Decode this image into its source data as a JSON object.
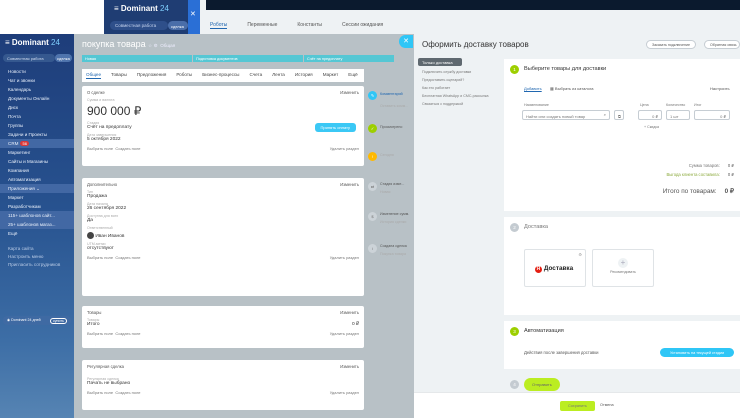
{
  "background_window": {
    "brand": "Dominant",
    "brand_num": "24",
    "workspace": "Совместная работа",
    "workspace_btn": "сделка",
    "tabs": [
      "Роботы",
      "Переменные",
      "Константы",
      "Сессии ожидания"
    ]
  },
  "sidebar": {
    "brand": "Dominant",
    "brand_num": "24",
    "workspace": "Совместная работа",
    "workspace_btn": "сделка",
    "items": [
      {
        "label": "Новости"
      },
      {
        "label": "Чат и звонки"
      },
      {
        "label": "Календарь"
      },
      {
        "label": "Документы Онлайн"
      },
      {
        "label": "Диск"
      },
      {
        "label": "Почта"
      },
      {
        "label": "Группы"
      },
      {
        "label": "Задачи и Проекты"
      },
      {
        "label": "CRM",
        "badge": "56"
      },
      {
        "label": "Маркетинг"
      },
      {
        "label": "Сайты и Магазины"
      },
      {
        "label": "Компания"
      },
      {
        "label": "Автоматизация"
      },
      {
        "label": "Приложения"
      },
      {
        "label": "Маркет"
      },
      {
        "label": "Разработчикам"
      },
      {
        "label": "115+ шаблонов сайт..."
      },
      {
        "label": "25+ шаблонов магаз..."
      },
      {
        "label": "Ещё"
      }
    ],
    "small_items": [
      "Карта сайта",
      "Настроить меню",
      "Пригласить сотрудников"
    ],
    "user": "Dominant 24 дней",
    "user_btn": "купить"
  },
  "deal": {
    "title": "покупка товара",
    "subtitle": "Общая",
    "stages": [
      "Новая",
      "Подготовка документов",
      "Счёт на предоплату"
    ],
    "tabs": [
      "Общее",
      "Товары",
      "Предложения",
      "Роботы",
      "Бизнес-процессы",
      "Счета",
      "Лента",
      "История",
      "Маркет",
      "Ещё"
    ],
    "about": {
      "header": "О сделке",
      "header_right": "Изменить",
      "amount_label": "Сумма и валюта",
      "amount": "900 000 ₽",
      "pay_btn": "Принять оплату",
      "stage_label": "Стадия",
      "stage": "Счёт на предоплату",
      "date_label": "Дата завершения",
      "date": "5 октября 2022",
      "link1": "Выбрать поле",
      "link2": "Создать поле",
      "link3": "Удалить раздел"
    },
    "more": {
      "header": "Дополнительно",
      "header_right": "Изменить",
      "type_label": "Тип",
      "type": "Продажа",
      "start_label": "Дата начала",
      "start": "26 сентября 2022",
      "avail_label": "Доступна для всех",
      "avail": "Да",
      "resp_label": "Ответственный",
      "resp": "Иван Иванов",
      "utm_label": "UTM-метки",
      "utm": "отсутствуют",
      "link1": "Выбрать поле",
      "link2": "Создать поле",
      "link3": "Удалить раздел"
    },
    "goods": {
      "header": "Товары",
      "header_right": "Изменить",
      "total_label": "Товары",
      "total": "Итого",
      "total_val": "0 ₽",
      "link1": "Выбрать поле",
      "link2": "Создать поле",
      "link3": "Удалить раздел"
    },
    "recurring": {
      "header": "Регулярная сделка",
      "header_right": "Изменить",
      "label": "Регулярная сделка",
      "value": "Пачать не выбрано",
      "link1": "Выбрать поле",
      "link2": "Создать поле",
      "link3": "Удалить раздел"
    },
    "timeline": [
      "Комментарий",
      "Оставить комм...",
      "Просмотрено",
      "Сегодня",
      "Стадия изме...",
      "Новая",
      "Изменение сумм.",
      "История сделки",
      "Создана сделка",
      "Покупка товара"
    ]
  },
  "panel": {
    "title": "Оформить доставку товаров",
    "btn_connect": "Заказать подключение",
    "btn_other": "Обратная связь",
    "left_menu_active": "Только доставка",
    "left_menu": [
      "Подключить службу доставки",
      "Предоставить сценарий?",
      "Как это работает",
      "Бесплатная WhatsApp и СМС-рассылка",
      "Связаться с поддержкой"
    ],
    "step1": {
      "num": "1",
      "title": "Выберите товары для доставки",
      "add": "Добавить",
      "from_catalog": "Выбрать из каталога",
      "settings": "Настроить",
      "col_name": "Наименование",
      "col_price": "Цена",
      "col_qty": "Количество",
      "col_unit": "Итог",
      "search_placeholder": "Найти или создать новый товар",
      "qty": "1",
      "unit": "шт",
      "price_val": "0 ₽",
      "discount": "Скидка",
      "sum_label": "Сумма товаров:",
      "sum_val": "0 ₽",
      "delivery_label": "Выгода клиента составила:",
      "delivery_val": "0 ₽",
      "total_label": "Итого по товарам:",
      "total_val": "0 ₽"
    },
    "step2": {
      "num": "2",
      "title": "Доставка",
      "yandex": "Доставка",
      "yandex_letter": "Я",
      "add_label": "Рекомендовать"
    },
    "step3": {
      "num": "3",
      "title": "Автоматизация",
      "desc": "Действия после завершения доставки",
      "btn": "Установить на текущей стадии"
    },
    "step4": {
      "num": "4",
      "btn": "Отправить"
    },
    "footer": {
      "save": "Сохранить",
      "cancel": "Отмена"
    }
  }
}
